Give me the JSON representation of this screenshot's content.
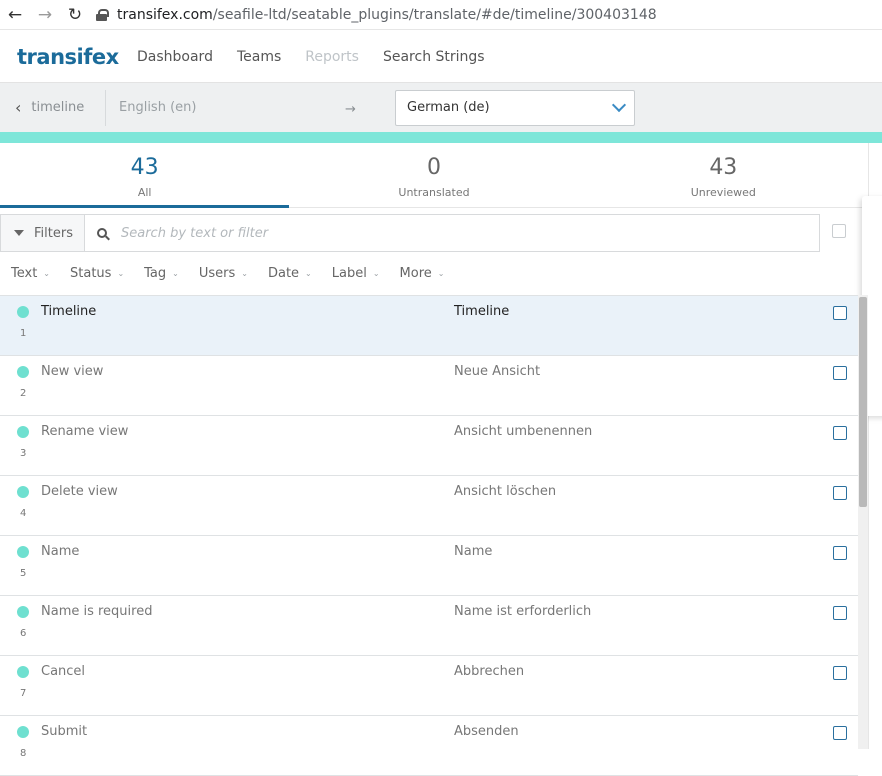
{
  "browser": {
    "back_icon": "arrow-left-icon",
    "forward_icon": "arrow-right-icon",
    "reload_icon": "reload-icon",
    "url_host": "transifex.com",
    "url_path": "/seafile-ltd/seatable_plugins/translate/#de/timeline/300403148"
  },
  "header": {
    "logo": "transifex",
    "nav": [
      {
        "label": "Dashboard",
        "enabled": true
      },
      {
        "label": "Teams",
        "enabled": true
      },
      {
        "label": "Reports",
        "enabled": false
      },
      {
        "label": "Search Strings",
        "enabled": true
      }
    ]
  },
  "lang_bar": {
    "back_label": "timeline",
    "source_language": "English (en)",
    "arrow": "→",
    "target_language": "German (de)"
  },
  "colors": {
    "brand": "#1b6b9a",
    "accent_band": "#7ee6d9",
    "status_dot": "#6fe0d0",
    "selected_row": "#eaf2f9"
  },
  "stats": [
    {
      "value": "43",
      "label": "All",
      "active": true
    },
    {
      "value": "0",
      "label": "Untranslated",
      "active": false
    },
    {
      "value": "43",
      "label": "Unreviewed",
      "active": false
    }
  ],
  "filters": {
    "button_label": "Filters",
    "search_placeholder": "Search by text or filter"
  },
  "columns": [
    "Text",
    "Status",
    "Tag",
    "Users",
    "Date",
    "Label",
    "More"
  ],
  "strings": [
    {
      "index": "1",
      "source": "Timeline",
      "target": "Timeline",
      "selected": true
    },
    {
      "index": "2",
      "source": "New view",
      "target": "Neue Ansicht",
      "selected": false
    },
    {
      "index": "3",
      "source": "Rename view",
      "target": "Ansicht umbenennen",
      "selected": false
    },
    {
      "index": "4",
      "source": "Delete view",
      "target": "Ansicht löschen",
      "selected": false
    },
    {
      "index": "5",
      "source": "Name",
      "target": "Name",
      "selected": false
    },
    {
      "index": "6",
      "source": "Name is required",
      "target": "Name ist erforderlich",
      "selected": false
    },
    {
      "index": "7",
      "source": "Cancel",
      "target": "Abbrechen",
      "selected": false
    },
    {
      "index": "8",
      "source": "Submit",
      "target": "Absenden",
      "selected": false
    }
  ]
}
